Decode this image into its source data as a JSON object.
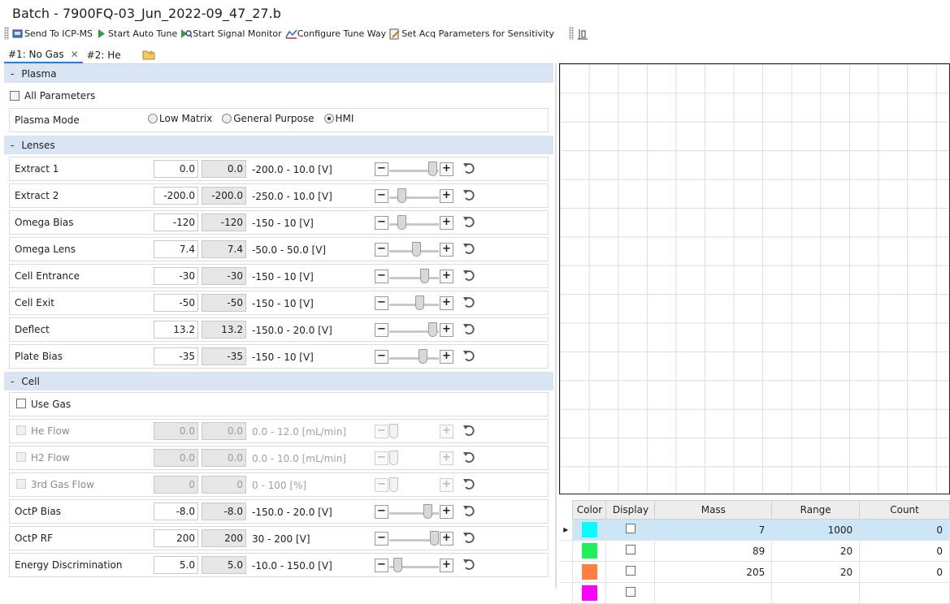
{
  "window": {
    "title": "Batch - 7900FQ-03_Jun_2022-09_47_27.b"
  },
  "toolbar": {
    "send": "Send To ICP-MS",
    "auto_tune": "Start Auto Tune",
    "signal_monitor": "Start Signal Monitor",
    "configure": "Configure Tune Way",
    "set_acq": "Set Acq Parameters for Sensitivity"
  },
  "tabs": [
    {
      "label": "#1: No Gas"
    },
    {
      "label": "#2: He"
    }
  ],
  "plasma": {
    "header": "Plasma",
    "all_parameters": "All Parameters",
    "mode_label": "Plasma Mode",
    "modes": [
      "Low Matrix",
      "General Purpose",
      "HMI"
    ],
    "selected_mode": "HMI"
  },
  "lenses": {
    "header": "Lenses",
    "rows": [
      {
        "label": "Extract 1",
        "value": "0.0",
        "actual": "0.0",
        "range": "-200.0  -  10.0  [V]",
        "level": 0.95
      },
      {
        "label": "Extract 2",
        "value": "-200.0",
        "actual": "-200.0",
        "range": "-250.0  -  10.0  [V]",
        "level": 0.19
      },
      {
        "label": "Omega Bias",
        "value": "-120",
        "actual": "-120",
        "range": "-150  -  10  [V]",
        "level": 0.19
      },
      {
        "label": "Omega Lens",
        "value": "7.4",
        "actual": "7.4",
        "range": "-50.0  -  50.0  [V]",
        "level": 0.57
      },
      {
        "label": "Cell Entrance",
        "value": "-30",
        "actual": "-30",
        "range": "-150  -  10  [V]",
        "level": 0.75
      },
      {
        "label": "Cell Exit",
        "value": "-50",
        "actual": "-50",
        "range": "-150  -  10  [V]",
        "level": 0.63
      },
      {
        "label": "Deflect",
        "value": "13.2",
        "actual": "13.2",
        "range": "-150.0  -  20.0  [V]",
        "level": 0.96
      },
      {
        "label": "Plate Bias",
        "value": "-35",
        "actual": "-35",
        "range": "-150  -  10  [V]",
        "level": 0.72
      }
    ]
  },
  "cell": {
    "header": "Cell",
    "use_gas": "Use Gas",
    "gas_rows": [
      {
        "label": "He Flow",
        "value": "0.0",
        "actual": "0.0",
        "range": "0.0  -  12.0  [mL/min]",
        "level": 0.0
      },
      {
        "label": "H2 Flow",
        "value": "0.0",
        "actual": "0.0",
        "range": "0.0  -  10.0  [mL/min]",
        "level": 0.0
      },
      {
        "label": "3rd Gas Flow",
        "value": "0",
        "actual": "0",
        "range": "0  -  100  [%]",
        "level": 0.0
      }
    ],
    "rows": [
      {
        "label": "OctP Bias",
        "value": "-8.0",
        "actual": "-8.0",
        "range": "-150.0  -  20.0  [V]",
        "level": 0.83
      },
      {
        "label": "OctP RF",
        "value": "200",
        "actual": "200",
        "range": "30  -  200  [V]",
        "level": 1.0
      },
      {
        "label": "Energy Discrimination",
        "value": "5.0",
        "actual": "5.0",
        "range": "-10.0  -  150.0  [V]",
        "level": 0.1
      }
    ]
  },
  "monitor_table": {
    "columns": [
      "Color",
      "Display",
      "Mass",
      "Range",
      "Count"
    ],
    "rows": [
      {
        "color": "#00ffff",
        "mass": "7",
        "range": "1000",
        "count": "0",
        "selected": true
      },
      {
        "color": "#1ef05a",
        "mass": "89",
        "range": "20",
        "count": "0",
        "selected": false
      },
      {
        "color": "#ff7f3f",
        "mass": "205",
        "range": "20",
        "count": "0",
        "selected": false
      },
      {
        "color": "#ff00ff",
        "mass": "",
        "range": "",
        "count": "",
        "selected": false
      }
    ]
  }
}
